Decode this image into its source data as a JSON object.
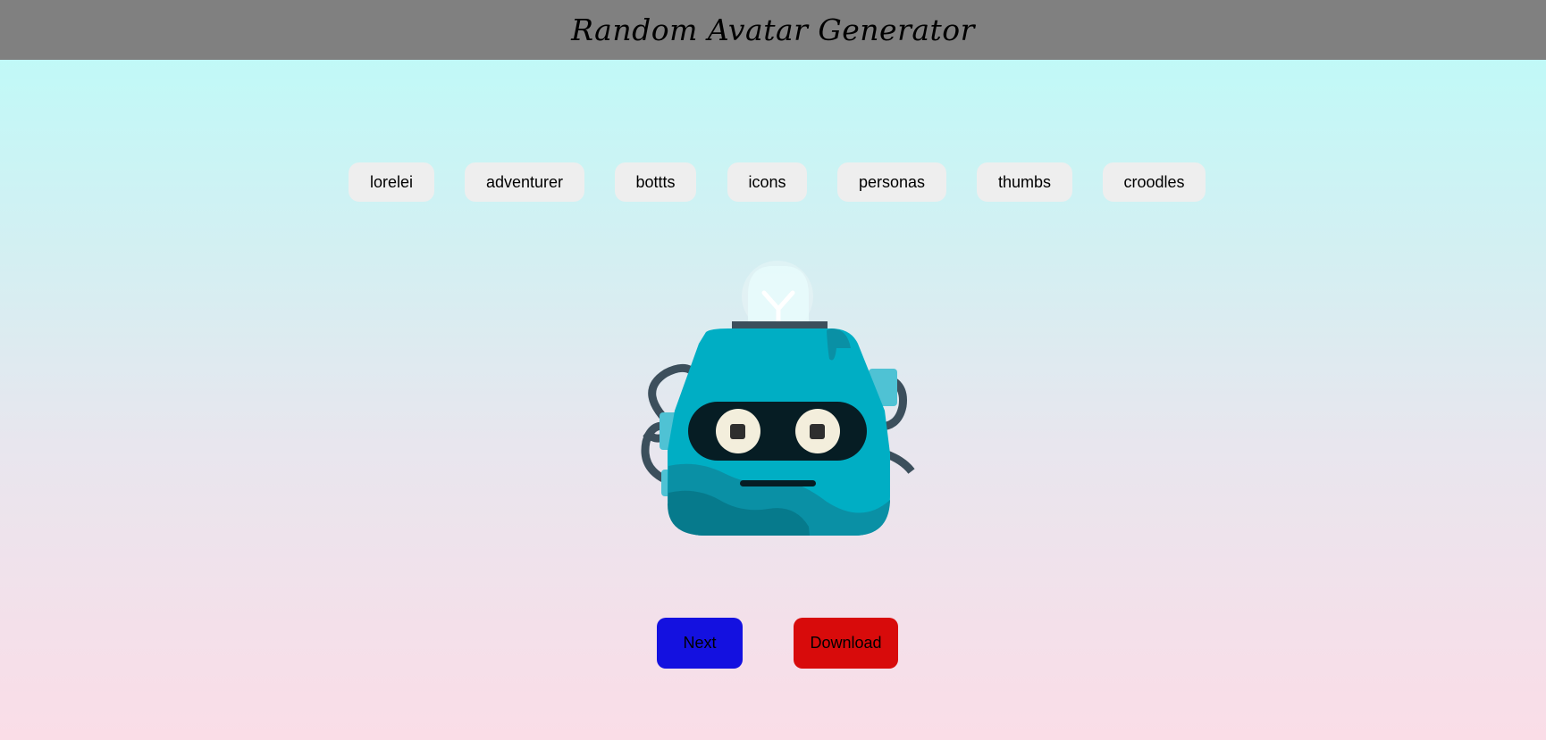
{
  "header": {
    "title": "Random Avatar Generator",
    "background": "#808080"
  },
  "styles": [
    {
      "label": "lorelei"
    },
    {
      "label": "adventurer"
    },
    {
      "label": "bottts"
    },
    {
      "label": "icons"
    },
    {
      "label": "personas"
    },
    {
      "label": "thumbs"
    },
    {
      "label": "croodles"
    }
  ],
  "avatar": {
    "icon": "robot-avatar-icon",
    "colors": {
      "head": "#00aec4",
      "visor": "#061d24",
      "eyes": "#f3eedc"
    }
  },
  "actions": {
    "next_label": "Next",
    "download_label": "Download",
    "next_color": "#1411e0",
    "download_color": "#d80b0b"
  }
}
